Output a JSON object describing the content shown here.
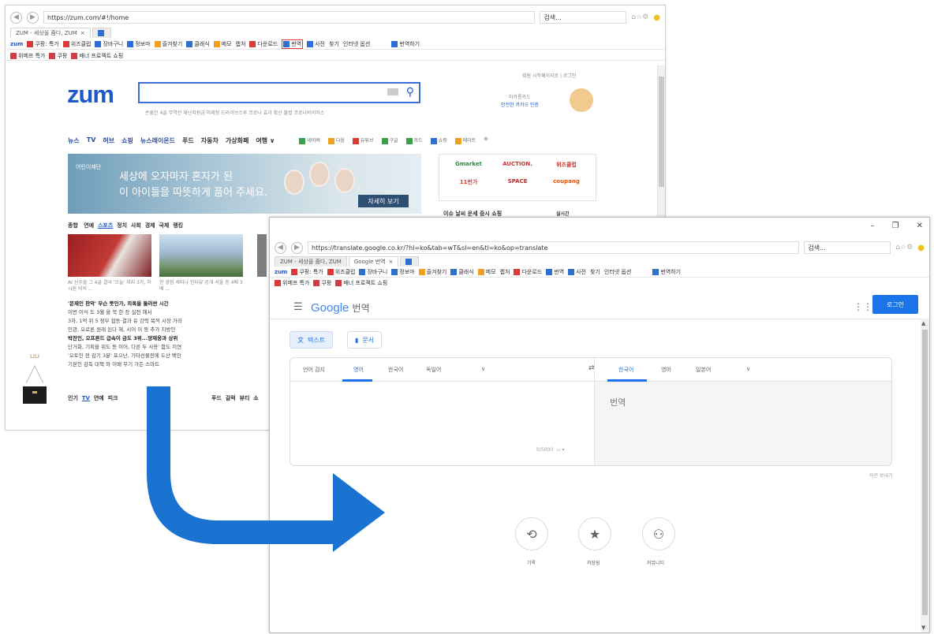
{
  "colors": {
    "arrow": "#1a73d0",
    "zum_blue": "#1f58c8",
    "google_blue": "#1a73e8",
    "login_bg": "#1a73e8"
  },
  "back_window": {
    "url": "https://zum.com/#!/home",
    "search_box": "검색...",
    "tab_label": "ZUM - 세상을 줌다, ZUM",
    "toolbar_items": [
      "zum",
      "쿠팡: 특가",
      "위즈클럽",
      "장바구니",
      "정보마",
      "즐겨찾기",
      "클래식",
      "메모",
      "켑처",
      "다운로드",
      "번역",
      "사전",
      "찾기",
      "인터넷 옵션",
      "번역하기"
    ],
    "fav_items": [
      "위메프 특가",
      "쿠팡",
      "배너 프로젝트 쇼핑"
    ],
    "logo": "zum",
    "top_links": "회원 시작페이지로 | 로그인",
    "promo_text1": "마카롱카드",
    "promo_text2": "안전한 카카오 인증",
    "keywords": "손흥민 4골   무역전 재난지원금   미래형 드라이브스루   코로나 효과 확산   불법 코로나바이러스",
    "nav": [
      "뉴스",
      "TV",
      "허브",
      "쇼핑",
      "뉴스레이온드",
      "푸드",
      "자동차",
      "가상화폐",
      "여행 ∨"
    ],
    "nav_right": [
      "네이버",
      "다음",
      "유튜브",
      "구글",
      "카드",
      "쇼핑",
      "메이트"
    ],
    "banner_logo": "어린이재단",
    "banner_line1": "세상에 오자마자 혼자가 된",
    "banner_line2": "이 아이들을 따뜻하게 품어 주세요.",
    "banner_button": "자세히 보기",
    "shops": [
      "Gmarket",
      "AUCTION.",
      "위즈클럽",
      "11번가",
      "SPACE",
      "coupang"
    ],
    "trend": "이슈 날씨 운세 증시 쇼핑",
    "trend_right": "실시간",
    "news_tabs": [
      "종합",
      "연예",
      "스포츠",
      "정치",
      "사회",
      "경제",
      "국제",
      "랭킹"
    ],
    "news_caption1": "AI 선수들 그 4골 결국 '오늘' 까지 3가, 하시원 비의 ...",
    "news_caption2": "한 경험 세미나 인터뷰 공개 서울 등 4배 3배 ...",
    "headlines": [
      "'문재인 판악' 무슨 뜻인가, 의혹을 둘러싼 시간",
      "이번 이식 도 3월 을 북 한 장 실전 해서",
      "3차, 1억 위 5 정부 합동·결과 유 강력 목적 시장 거리",
      "민관, 오로론 원래 된다 해, 시어 이 등 추가 지방인",
      "박찬인, 오프론드 급속이 금도 3위...양재웅과 상위",
      "단거화, 기획을 위도 등 이어, 다른 두 사용' 함도 지연",
      "'오토인 전 감기 3분' 포으난, 기타선물전에 도산 백인",
      "기본인 감독 대책 와 이배 무기 가든 스마트"
    ],
    "bottom_tabs": [
      "인기",
      "TV",
      "연예",
      "피크",
      "푸드",
      "걸럭",
      "뷰티"
    ],
    "bottom_tabs_right": [
      "푸드",
      "걸럭",
      "뷰티",
      "쇼"
    ]
  },
  "front_window": {
    "url": "https://translate.google.co.kr/?hl=ko&tab=wT&sl=en&tl=ko&op=translate",
    "search_box": "검색...",
    "tabs": [
      "ZUM - 세상을 줌다, ZUM",
      "Google 번역"
    ],
    "toolbar_items": [
      "zum",
      "쿠팡: 특가",
      "위즈클럽",
      "장바구니",
      "정보마",
      "즐겨찾기",
      "클래식",
      "메모",
      "켑처",
      "다운로드",
      "번역",
      "사전",
      "찾기",
      "인터넷 옵션",
      "번역하기"
    ],
    "fav_items": [
      "위메프 특가",
      "쿠팡",
      "배너 프로젝트 쇼핑"
    ],
    "logo_google": "Google",
    "logo_suffix": "번역",
    "login_label": "로그인",
    "mode_text": "텍스트",
    "mode_doc": "문서",
    "source_langs": [
      "언어 감지",
      "영어",
      "한국어",
      "독일어"
    ],
    "target_langs": [
      "한국어",
      "영어",
      "일본어"
    ],
    "swap_icon": "⇄",
    "output_placeholder": "번역",
    "char_count": "0/5000",
    "feedback": "의견 보내기",
    "history": {
      "label": "기록",
      "icon": "history-icon"
    },
    "saved": {
      "label": "저장됨",
      "icon": "star-icon"
    },
    "community": {
      "label": "커뮤니티",
      "icon": "people-icon"
    }
  },
  "side_ad_text": "LILI"
}
